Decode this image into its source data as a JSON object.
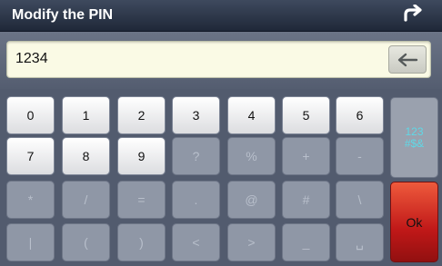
{
  "titlebar": {
    "title": "Modify the PIN",
    "back_icon": "return-arrow-icon"
  },
  "input": {
    "value": "1234",
    "backspace_icon": "backspace-arrow-icon"
  },
  "keypad": {
    "rows": [
      [
        "0",
        "1",
        "2",
        "3",
        "4",
        "5",
        "6"
      ],
      [
        "7",
        "8",
        "9",
        "?",
        "%",
        "+",
        "-"
      ],
      [
        "*",
        "/",
        "=",
        ".",
        "@",
        "#",
        "\\"
      ],
      [
        "|",
        "(",
        ")",
        "<",
        ">",
        "_",
        "␣"
      ]
    ],
    "mode_key": {
      "line1": "123",
      "line2": "#$&"
    },
    "ok_label": "Ok"
  }
}
